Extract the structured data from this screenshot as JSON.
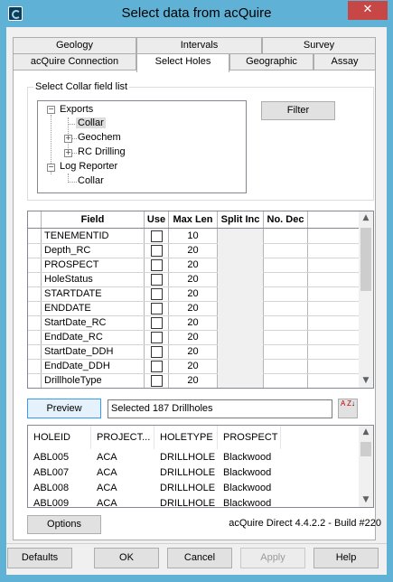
{
  "window": {
    "title": "Select data from acQuire",
    "close_glyph": "✕"
  },
  "tabs_row1": [
    {
      "label": "Geology"
    },
    {
      "label": "Intervals"
    },
    {
      "label": "Survey"
    }
  ],
  "tabs_row2": [
    {
      "label": "acQuire Connection"
    },
    {
      "label": "Select Holes"
    },
    {
      "label": "Geographic"
    },
    {
      "label": "Assay"
    }
  ],
  "active_tab": "Select Holes",
  "collar_group": {
    "label": "Select Collar field list",
    "tree": [
      {
        "label": "Exports",
        "expander": "−"
      },
      {
        "label": "Collar",
        "selected": true
      },
      {
        "label": "Geochem",
        "expander": "+"
      },
      {
        "label": "RC Drilling",
        "expander": "+"
      },
      {
        "label": "Log Reporter",
        "expander": "−"
      },
      {
        "label": "Collar"
      }
    ],
    "filter_button": "Filter"
  },
  "field_grid": {
    "headers": {
      "field": "Field",
      "use": "Use",
      "max_len": "Max Len",
      "split_inc": "Split Inc",
      "no_dec": "No. Dec"
    },
    "rows": [
      {
        "field": "TENEMENTID",
        "max_len": "10"
      },
      {
        "field": "Depth_RC",
        "max_len": "20"
      },
      {
        "field": "PROSPECT",
        "max_len": "20"
      },
      {
        "field": "HoleStatus",
        "max_len": "20"
      },
      {
        "field": "STARTDATE",
        "max_len": "20"
      },
      {
        "field": "ENDDATE",
        "max_len": "20"
      },
      {
        "field": "StartDate_RC",
        "max_len": "20"
      },
      {
        "field": "EndDate_RC",
        "max_len": "20"
      },
      {
        "field": "StartDate_DDH",
        "max_len": "20"
      },
      {
        "field": "EndDate_DDH",
        "max_len": "20"
      },
      {
        "field": "DrillholeType",
        "max_len": "20"
      }
    ]
  },
  "preview": {
    "button": "Preview",
    "status": "Selected 187 Drillholes",
    "sort_icon_text": "A Z"
  },
  "holes_list": {
    "headers": [
      "HOLEID",
      "PROJECT...",
      "HOLETYPE",
      "PROSPECT"
    ],
    "rows": [
      [
        "ABL005",
        "ACA",
        "DRILLHOLE",
        "Blackwood"
      ],
      [
        "ABL007",
        "ACA",
        "DRILLHOLE",
        "Blackwood"
      ],
      [
        "ABL008",
        "ACA",
        "DRILLHOLE",
        "Blackwood"
      ],
      [
        "ABL009",
        "ACA",
        "DRILLHOLE",
        "Blackwood"
      ]
    ]
  },
  "options_button": "Options",
  "build_text": "acQuire Direct 4.4.2.2 - Build #220",
  "footer": {
    "defaults": "Defaults",
    "ok": "OK",
    "cancel": "Cancel",
    "apply": "Apply",
    "help": "Help"
  },
  "colors": {
    "title_bar": "#5fb2d6",
    "close": "#c74646",
    "selection": "#dcdcdc",
    "focus_border": "#3399ff"
  }
}
